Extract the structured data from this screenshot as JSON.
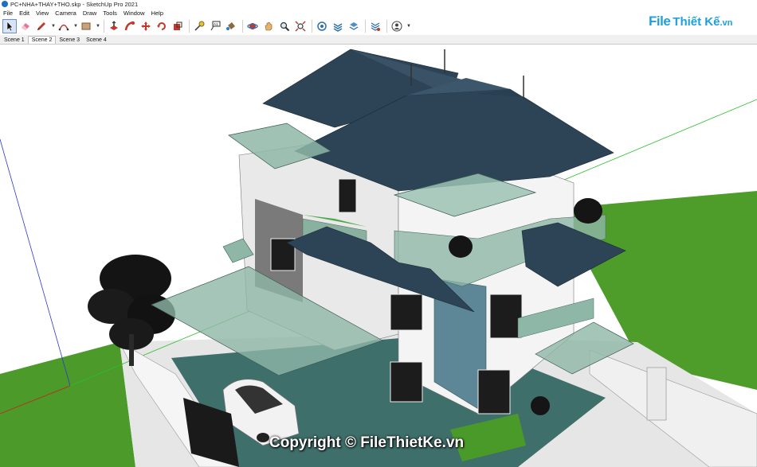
{
  "window": {
    "title": "PC+NHA+THAY+THO.skp - SketchUp Pro 2021"
  },
  "menu": [
    "File",
    "Edit",
    "View",
    "Camera",
    "Draw",
    "Tools",
    "Window",
    "Help"
  ],
  "toolbar": {
    "tools": [
      "select",
      "eraser",
      "line",
      "arc",
      "shape",
      "push-pull",
      "follow-me",
      "move",
      "rotate",
      "scale",
      "tape-measure",
      "text",
      "paint-bucket",
      "orbit",
      "pan",
      "zoom",
      "zoom-extents",
      "3d-warehouse",
      "extension-warehouse",
      "layout",
      "extension-manager",
      "account"
    ]
  },
  "brand": {
    "logo_mark": "File",
    "logo_text": "Thiết Kế",
    "logo_tld": ".vn"
  },
  "scenes": {
    "tabs": [
      "Scene 1",
      "Scene 2",
      "Scene 3",
      "Scene 4"
    ],
    "active": "Scene 2"
  },
  "watermark": "Copyright © FileThietKe.vn",
  "colors": {
    "roof": "#2d4356",
    "wall_white": "#f3f3f3",
    "wall_teal": "#5d8796",
    "glass": "#8fb7a8",
    "lawn": "#4c9a2a",
    "sky": "#ffffff",
    "paving": "#3f6f6a"
  }
}
